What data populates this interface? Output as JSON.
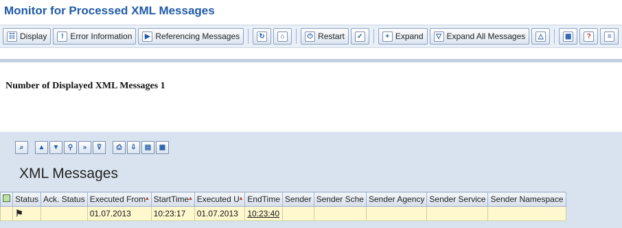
{
  "window": {
    "title": "Monitor for Processed XML Messages"
  },
  "toolbar": {
    "display": "Display",
    "error_info": "Error Information",
    "referencing": "Referencing Messages",
    "restart": "Restart",
    "expand": "Expand",
    "expand_all": "Expand All Messages"
  },
  "summary": {
    "text": "Number of Displayed XML Messages 1"
  },
  "grid": {
    "title": "XML Messages",
    "columns": [
      "Status",
      "Ack. Status",
      "Executed From",
      "StartTime",
      "Executed U",
      "EndTime",
      "Sender",
      "Sender Sche",
      "Sender Agency",
      "Sender Service",
      "Sender Namespace"
    ],
    "rows": [
      {
        "status": "⚑",
        "ack": "",
        "executed_from": "01.07.2013",
        "start_time": "10:23:17",
        "executed_until": "01.07.2013",
        "end_time": "10:23:40",
        "sender": "",
        "sender_scheme": "",
        "sender_agency": "",
        "sender_service": "",
        "sender_namespace": ""
      }
    ]
  }
}
